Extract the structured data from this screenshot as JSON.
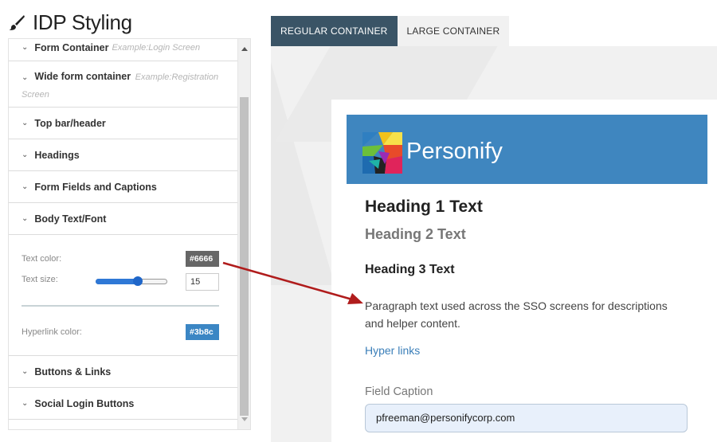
{
  "header": {
    "title": "IDP Styling",
    "icon": "paintbrush-icon"
  },
  "sections": [
    {
      "label": "Form Container",
      "example": "Example:Login Screen"
    },
    {
      "label": "Wide form container",
      "example": "Example:Registration Screen"
    },
    {
      "label": "Top bar/header"
    },
    {
      "label": "Headings"
    },
    {
      "label": "Form Fields and Captions"
    },
    {
      "label": "Body Text/Font"
    },
    {
      "label": "Buttons & Links"
    },
    {
      "label": "Social Login Buttons"
    }
  ],
  "body_text": {
    "text_color_label": "Text color:",
    "text_color_value": "#6666",
    "text_color_swatch": "#666666",
    "text_size_label": "Text size:",
    "text_size_value": "15",
    "text_size_slider_fraction": 0.6,
    "hyperlink_color_label": "Hyperlink color:",
    "hyperlink_color_value": "#3b8c",
    "hyperlink_color_swatch": "#3b86c4"
  },
  "tabs": [
    {
      "label": "REGULAR CONTAINER",
      "active": true
    },
    {
      "label": "LARGE CONTAINER",
      "active": false
    }
  ],
  "preview": {
    "brand_name": "Personify",
    "brand_color": "#3f86bf",
    "heading1": "Heading 1 Text",
    "heading2": "Heading 2 Text",
    "heading3": "Heading 3 Text",
    "paragraph": "Paragraph text used across the SSO screens for descriptions and helper content.",
    "hyperlink": "Hyper links",
    "field_caption": "Field Caption",
    "email_value": "pfreeman@personifycorp.com"
  },
  "annotation_color": "#b01c1c"
}
